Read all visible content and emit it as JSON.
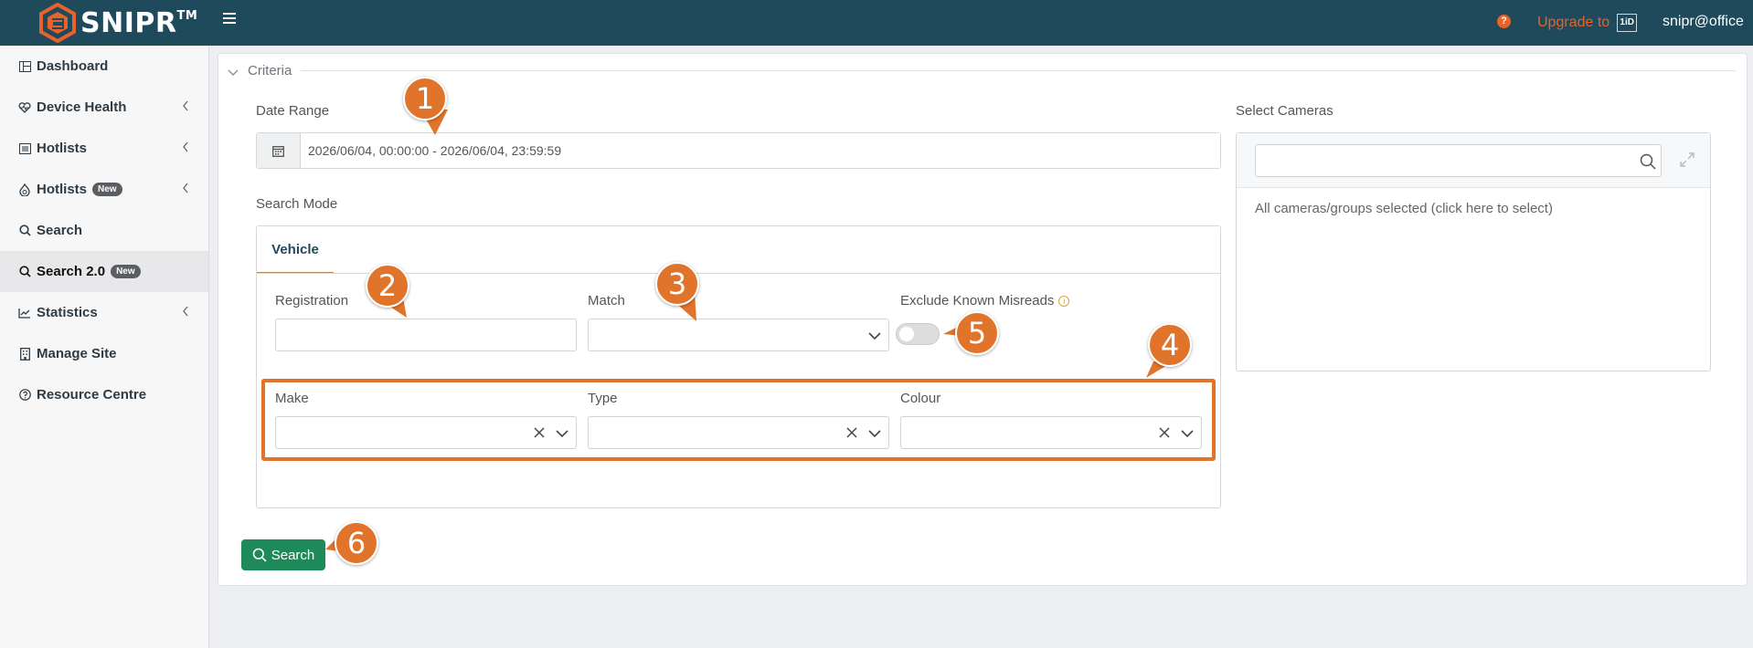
{
  "app": {
    "logo_text": "SNIPR",
    "logo_tm": "TM",
    "help_glyph": "?",
    "upgrade_label": "Upgrade to",
    "upgrade_badge": "1iD",
    "user": "snipr@office"
  },
  "sidebar": {
    "items": [
      {
        "label": "Dashboard",
        "icon": "dashboard-icon"
      },
      {
        "label": "Device Health",
        "icon": "heart-pulse-icon"
      },
      {
        "label": "Hotlists",
        "icon": "list-icon"
      },
      {
        "label": "Hotlists",
        "icon": "fire-icon",
        "badge": "New"
      },
      {
        "label": "Search",
        "icon": "search-icon"
      },
      {
        "label": "Search 2.0",
        "icon": "search-icon",
        "badge": "New"
      },
      {
        "label": "Statistics",
        "icon": "chart-line-icon"
      },
      {
        "label": "Manage Site",
        "icon": "building-icon"
      },
      {
        "label": "Resource Centre",
        "icon": "question-circle-icon"
      }
    ]
  },
  "criteria": {
    "title": "Criteria",
    "date_range_label": "Date Range",
    "date_range_value": "2026/06/04, 00:00:00 - 2026/06/04, 23:59:59",
    "search_mode_label": "Search Mode",
    "tab_vehicle": "Vehicle",
    "registration_label": "Registration",
    "registration_value": "",
    "match_label": "Match",
    "exclude_label": "Exclude Known Misreads",
    "info_glyph": "i",
    "exclude_enabled": false,
    "make_label": "Make",
    "type_label": "Type",
    "colour_label": "Colour",
    "search_button": "Search"
  },
  "cameras": {
    "label": "Select Cameras",
    "search_value": "",
    "selection_text": "All cameras/groups selected (click here to select)"
  },
  "callouts": [
    "1",
    "2",
    "3",
    "4",
    "5",
    "6"
  ],
  "colors": {
    "topbar": "#1f4a5c",
    "accent": "#e0742a",
    "button": "#1e8a5a"
  }
}
